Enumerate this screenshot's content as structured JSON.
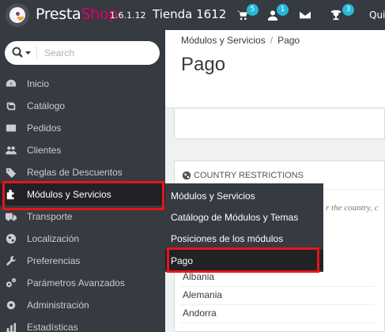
{
  "header": {
    "brand_presta": "Presta",
    "brand_shop": "Shop",
    "version": "1.6.1.12",
    "shop_name": "Tienda 1612",
    "user_label_truncated": "Qui",
    "icons": [
      {
        "name": "cart-icon",
        "badge": "5"
      },
      {
        "name": "customer-icon",
        "badge": "1"
      },
      {
        "name": "envelope-icon",
        "badge": ""
      },
      {
        "name": "trophy-icon",
        "badge": "3"
      }
    ]
  },
  "sidebar": {
    "search": {
      "placeholder": "Search"
    },
    "items": [
      {
        "label": "Inicio",
        "icon": "dashboard-icon"
      },
      {
        "label": "Catálogo",
        "icon": "book-icon"
      },
      {
        "label": "Pedidos",
        "icon": "credit-card-icon"
      },
      {
        "label": "Clientes",
        "icon": "users-icon"
      },
      {
        "label": "Reglas de Descuentos",
        "icon": "tags-icon"
      },
      {
        "label": "Módulos y Servicios",
        "icon": "puzzle-icon",
        "active": true
      },
      {
        "label": "Transporte",
        "icon": "truck-icon"
      },
      {
        "label": "Localización",
        "icon": "globe-icon"
      },
      {
        "label": "Preferencias",
        "icon": "wrench-icon"
      },
      {
        "label": "Parámetros Avanzados",
        "icon": "cogs-icon"
      },
      {
        "label": "Administración",
        "icon": "cog-icon"
      },
      {
        "label": "Estadísticas",
        "icon": "chart-icon"
      }
    ]
  },
  "submenu": {
    "items": [
      {
        "label": "Módulos y Servicios"
      },
      {
        "label": "Catálogo de Módulos y Temas"
      },
      {
        "label": "Posiciones de los módulos"
      },
      {
        "label": "Pago",
        "active": true
      }
    ]
  },
  "main": {
    "breadcrumb": [
      "Módulos y Servicios",
      "Pago"
    ],
    "breadcrumb_sep": "/",
    "page_title": "Pago",
    "panel": {
      "title": "COUNTRY RESTRICTIONS",
      "icon": "globe-icon",
      "hint_fragment": "r the country, c"
    },
    "countries": [
      "Albania",
      "Alemania",
      "Andorra"
    ]
  },
  "colors": {
    "dark_bg": "#363a41",
    "active_bg": "#202226",
    "highlight": "#e8131a",
    "badge": "#25b9d7",
    "brand_pink": "#df0067"
  }
}
